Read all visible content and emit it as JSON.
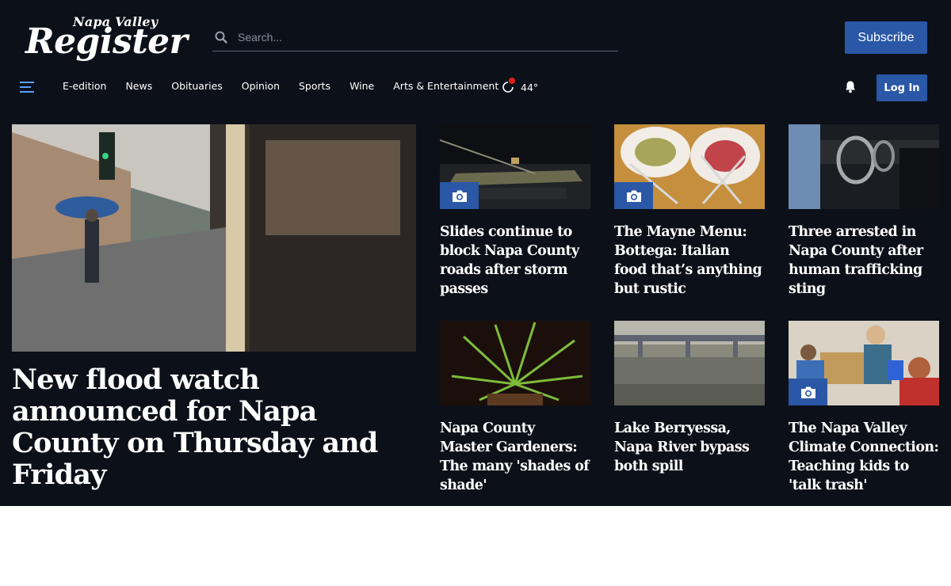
{
  "header": {
    "logo_small": "Napa Valley",
    "logo_big": "Register",
    "search_placeholder": "Search...",
    "subscribe_label": "Subscribe",
    "login_label": "Log In"
  },
  "nav": {
    "items": [
      {
        "label": "E-edition"
      },
      {
        "label": "News"
      },
      {
        "label": "Obituaries"
      },
      {
        "label": "Opinion"
      },
      {
        "label": "Sports"
      },
      {
        "label": "Wine"
      },
      {
        "label": "Arts & Entertainment"
      }
    ],
    "weather": "44°"
  },
  "lead": {
    "title": "New flood watch announced for Napa County on Thursday and Friday"
  },
  "cards": [
    {
      "title": "Slides continue to block Napa County roads after storm passes",
      "gallery": true
    },
    {
      "title": "The Mayne Menu: Bottega: Italian food that’s anything but rustic",
      "gallery": true
    },
    {
      "title": "Three arrested in Napa County after human trafficking sting",
      "gallery": false
    },
    {
      "title": "Napa County Master Gardeners: The many 'shades of shade'",
      "gallery": false
    },
    {
      "title": "Lake Berryessa, Napa River bypass both spill",
      "gallery": false
    },
    {
      "title": "The Napa Valley Climate Connection: Teaching kids to 'talk trash'",
      "gallery": true
    }
  ],
  "colors": {
    "page_bg": "#0c1018",
    "accent": "#2a57a6",
    "menu_icon": "#5aa0ff",
    "weather_alert": "#e0201b"
  }
}
